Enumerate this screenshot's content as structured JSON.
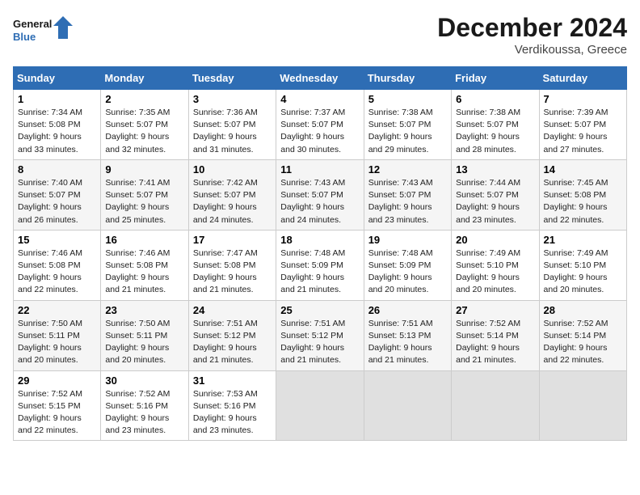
{
  "header": {
    "logo_line1": "General",
    "logo_line2": "Blue",
    "month": "December 2024",
    "location": "Verdikoussa, Greece"
  },
  "weekdays": [
    "Sunday",
    "Monday",
    "Tuesday",
    "Wednesday",
    "Thursday",
    "Friday",
    "Saturday"
  ],
  "weeks": [
    [
      {
        "day": "1",
        "sunrise": "7:34 AM",
        "sunset": "5:08 PM",
        "daylight": "9 hours and 33 minutes."
      },
      {
        "day": "2",
        "sunrise": "7:35 AM",
        "sunset": "5:07 PM",
        "daylight": "9 hours and 32 minutes."
      },
      {
        "day": "3",
        "sunrise": "7:36 AM",
        "sunset": "5:07 PM",
        "daylight": "9 hours and 31 minutes."
      },
      {
        "day": "4",
        "sunrise": "7:37 AM",
        "sunset": "5:07 PM",
        "daylight": "9 hours and 30 minutes."
      },
      {
        "day": "5",
        "sunrise": "7:38 AM",
        "sunset": "5:07 PM",
        "daylight": "9 hours and 29 minutes."
      },
      {
        "day": "6",
        "sunrise": "7:38 AM",
        "sunset": "5:07 PM",
        "daylight": "9 hours and 28 minutes."
      },
      {
        "day": "7",
        "sunrise": "7:39 AM",
        "sunset": "5:07 PM",
        "daylight": "9 hours and 27 minutes."
      }
    ],
    [
      {
        "day": "8",
        "sunrise": "7:40 AM",
        "sunset": "5:07 PM",
        "daylight": "9 hours and 26 minutes."
      },
      {
        "day": "9",
        "sunrise": "7:41 AM",
        "sunset": "5:07 PM",
        "daylight": "9 hours and 25 minutes."
      },
      {
        "day": "10",
        "sunrise": "7:42 AM",
        "sunset": "5:07 PM",
        "daylight": "9 hours and 24 minutes."
      },
      {
        "day": "11",
        "sunrise": "7:43 AM",
        "sunset": "5:07 PM",
        "daylight": "9 hours and 24 minutes."
      },
      {
        "day": "12",
        "sunrise": "7:43 AM",
        "sunset": "5:07 PM",
        "daylight": "9 hours and 23 minutes."
      },
      {
        "day": "13",
        "sunrise": "7:44 AM",
        "sunset": "5:07 PM",
        "daylight": "9 hours and 23 minutes."
      },
      {
        "day": "14",
        "sunrise": "7:45 AM",
        "sunset": "5:08 PM",
        "daylight": "9 hours and 22 minutes."
      }
    ],
    [
      {
        "day": "15",
        "sunrise": "7:46 AM",
        "sunset": "5:08 PM",
        "daylight": "9 hours and 22 minutes."
      },
      {
        "day": "16",
        "sunrise": "7:46 AM",
        "sunset": "5:08 PM",
        "daylight": "9 hours and 21 minutes."
      },
      {
        "day": "17",
        "sunrise": "7:47 AM",
        "sunset": "5:08 PM",
        "daylight": "9 hours and 21 minutes."
      },
      {
        "day": "18",
        "sunrise": "7:48 AM",
        "sunset": "5:09 PM",
        "daylight": "9 hours and 21 minutes."
      },
      {
        "day": "19",
        "sunrise": "7:48 AM",
        "sunset": "5:09 PM",
        "daylight": "9 hours and 20 minutes."
      },
      {
        "day": "20",
        "sunrise": "7:49 AM",
        "sunset": "5:10 PM",
        "daylight": "9 hours and 20 minutes."
      },
      {
        "day": "21",
        "sunrise": "7:49 AM",
        "sunset": "5:10 PM",
        "daylight": "9 hours and 20 minutes."
      }
    ],
    [
      {
        "day": "22",
        "sunrise": "7:50 AM",
        "sunset": "5:11 PM",
        "daylight": "9 hours and 20 minutes."
      },
      {
        "day": "23",
        "sunrise": "7:50 AM",
        "sunset": "5:11 PM",
        "daylight": "9 hours and 20 minutes."
      },
      {
        "day": "24",
        "sunrise": "7:51 AM",
        "sunset": "5:12 PM",
        "daylight": "9 hours and 21 minutes."
      },
      {
        "day": "25",
        "sunrise": "7:51 AM",
        "sunset": "5:12 PM",
        "daylight": "9 hours and 21 minutes."
      },
      {
        "day": "26",
        "sunrise": "7:51 AM",
        "sunset": "5:13 PM",
        "daylight": "9 hours and 21 minutes."
      },
      {
        "day": "27",
        "sunrise": "7:52 AM",
        "sunset": "5:14 PM",
        "daylight": "9 hours and 21 minutes."
      },
      {
        "day": "28",
        "sunrise": "7:52 AM",
        "sunset": "5:14 PM",
        "daylight": "9 hours and 22 minutes."
      }
    ],
    [
      {
        "day": "29",
        "sunrise": "7:52 AM",
        "sunset": "5:15 PM",
        "daylight": "9 hours and 22 minutes."
      },
      {
        "day": "30",
        "sunrise": "7:52 AM",
        "sunset": "5:16 PM",
        "daylight": "9 hours and 23 minutes."
      },
      {
        "day": "31",
        "sunrise": "7:53 AM",
        "sunset": "5:16 PM",
        "daylight": "9 hours and 23 minutes."
      },
      null,
      null,
      null,
      null
    ]
  ]
}
